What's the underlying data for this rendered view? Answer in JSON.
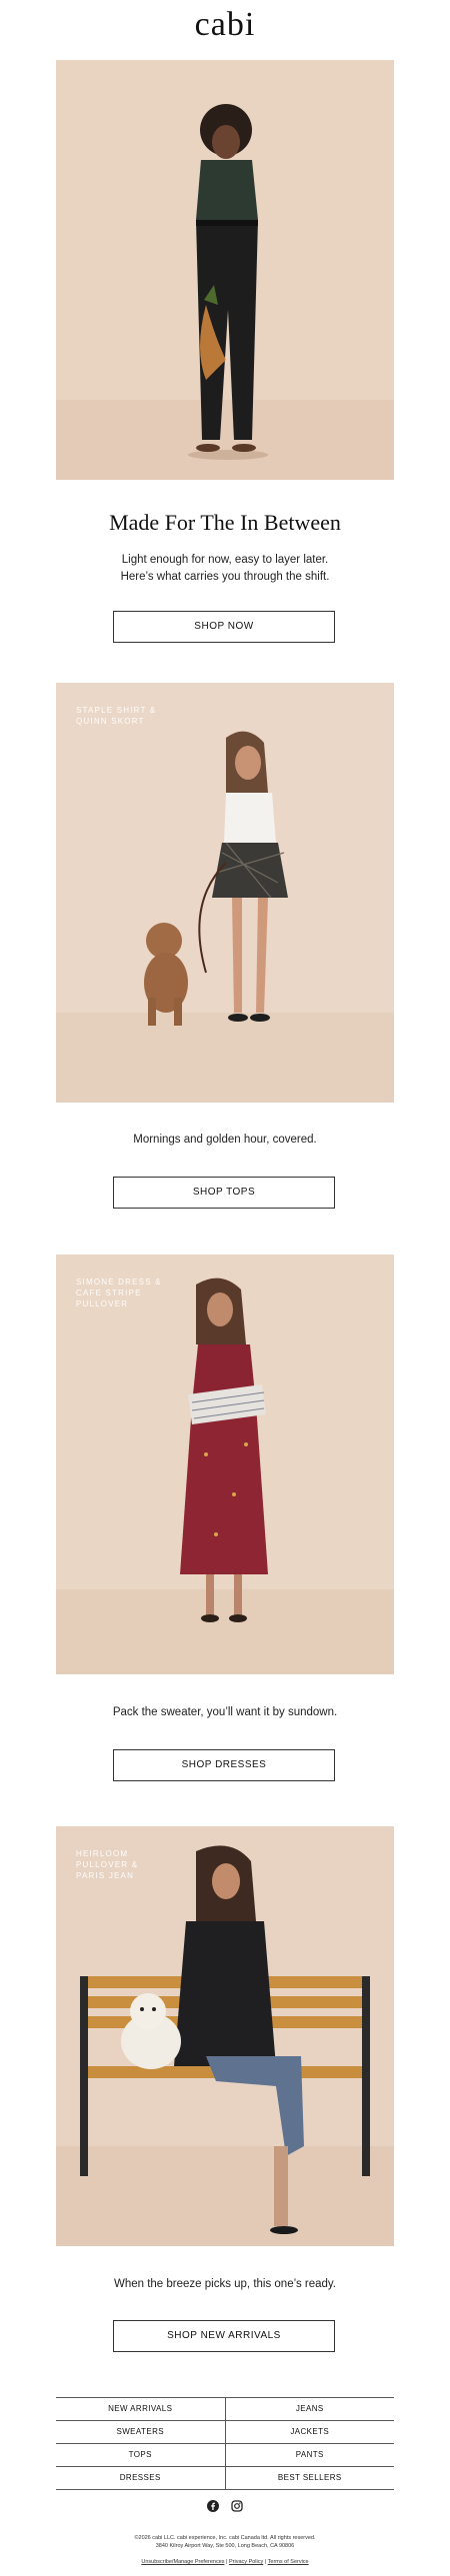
{
  "brand": {
    "logo": "cabi"
  },
  "hero": {
    "headline": "Made For The In Between",
    "subline_1": "Light enough for now, easy to layer later.",
    "subline_2": "Here’s what carries you through the shift.",
    "cta": "SHOP NOW"
  },
  "sections": [
    {
      "overlay": "STAPLE SHIRT &\nQUINN SKORT",
      "caption": "Mornings and golden hour, covered.",
      "cta": "SHOP TOPS"
    },
    {
      "overlay": "SIMONE DRESS &\nCAFE STRIPE\nPULLOVER",
      "caption": "Pack the sweater, you’ll want it by sundown.",
      "cta": "SHOP DRESSES"
    },
    {
      "overlay": "HEIRLOOM\nPULLOVER &\nPARIS JEAN",
      "caption": "When the breeze picks up, this one’s ready.",
      "cta": "SHOP NEW ARRIVALS"
    }
  ],
  "nav": [
    [
      "NEW ARRIVALS",
      "JEANS"
    ],
    [
      "SWEATERS",
      "JACKETS"
    ],
    [
      "TOPS",
      "PANTS"
    ],
    [
      "DRESSES",
      "BEST SELLERS"
    ]
  ],
  "social": {
    "icons": [
      "facebook-icon",
      "instagram-icon"
    ]
  },
  "footer": {
    "legal_1": "©2026 cabi LLC. cabi experience, Inc. cabi Canada ltd. All rights reserved.",
    "legal_2": "3840 Kilroy Airport Way, Ste 500, Long Beach, CA 90806",
    "link_unsubscribe": "Unsubscribe/Manage Preferences",
    "link_privacy": "Privacy Policy",
    "link_terms": "Terms of Service",
    "separator": "|"
  },
  "colors": {
    "photo_bg": "#e8d4c3",
    "text": "#222222",
    "border": "#333333"
  }
}
